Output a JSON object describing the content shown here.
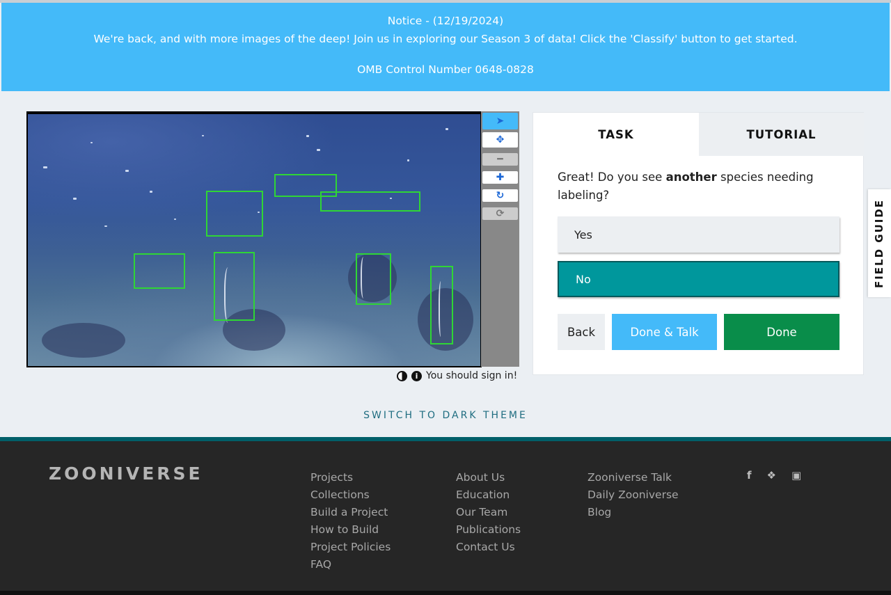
{
  "notice": {
    "title": "Notice - (12/19/2024)",
    "message": "We're back, and with more images of the deep! Join us in exploring our Season 3 of data! Click the 'Classify' button to get started.",
    "omb": "OMB Control Number 0648-0828"
  },
  "toolbar": {
    "tools": [
      {
        "name": "pointer-icon",
        "glyph": "➤"
      },
      {
        "name": "move-icon",
        "glyph": "✥"
      },
      {
        "name": "zoom-out-icon",
        "glyph": "━"
      },
      {
        "name": "zoom-in-icon",
        "glyph": "✚"
      },
      {
        "name": "rotate-icon",
        "glyph": "↻"
      },
      {
        "name": "reset-icon",
        "glyph": "⟳"
      }
    ]
  },
  "viewer": {
    "signin_text": "You should sign in!",
    "icons": [
      "contrast-icon",
      "info-icon"
    ]
  },
  "task": {
    "tab_task": "TASK",
    "tab_tutorial": "TUTORIAL",
    "question_pre": "Great! Do you see ",
    "question_bold": "another",
    "question_post": " species needing labeling?",
    "answers": {
      "yes": "Yes",
      "no": "No"
    },
    "buttons": {
      "back": "Back",
      "done_talk": "Done & Talk",
      "done": "Done"
    }
  },
  "field_guide": "FIELD GUIDE",
  "theme_toggle": "SWITCH TO DARK THEME",
  "footer": {
    "logo": "ZOONIVERSE",
    "col1": [
      "Projects",
      "Collections",
      "Build a Project",
      "How to Build",
      "Project Policies",
      "FAQ"
    ],
    "col2": [
      "About Us",
      "Education",
      "Our Team",
      "Publications",
      "Contact Us"
    ],
    "col3": [
      "Zooniverse Talk",
      "Daily Zooniverse",
      "Blog"
    ],
    "social": [
      "facebook-icon",
      "twitter-icon",
      "instagram-icon"
    ]
  },
  "colors": {
    "notice_bg": "#44baf9",
    "no_answer": "#00979c",
    "done": "#098d4a",
    "done_talk": "#44baf9",
    "footer_bg": "#262626"
  }
}
